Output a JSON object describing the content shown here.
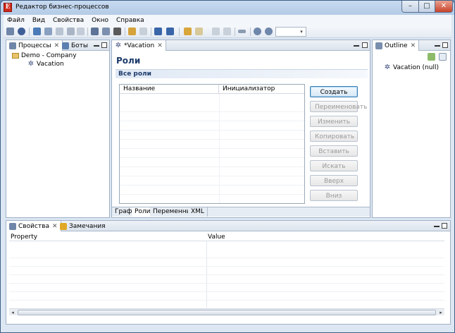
{
  "window": {
    "title": "Редактор бизнес-процессов",
    "min_glyph": "–",
    "max_glyph": "□",
    "close_glyph": "✕"
  },
  "menu": {
    "items": [
      "Файл",
      "Вид",
      "Свойства",
      "Окно",
      "Справка"
    ]
  },
  "toolbar": {
    "zoom_value": "",
    "combo_arrow": "▾"
  },
  "processes_panel": {
    "tabs": [
      {
        "label": "Процессы",
        "close": "✕"
      },
      {
        "label": "Боты"
      }
    ],
    "tree": {
      "root": "Demo - Company",
      "child": "Vacation"
    }
  },
  "editor": {
    "tab_label": "*Vacation",
    "tab_close": "✕",
    "title": "Роли",
    "section_title": "Все роли",
    "table": {
      "columns": [
        "Название",
        "Инициализатор"
      ],
      "rows": []
    },
    "buttons": [
      "Создать",
      "Переименовать",
      "Изменить",
      "Копировать",
      "Вставить",
      "Искать",
      "Вверх",
      "Вниз"
    ],
    "bottom_tabs": [
      "Граф",
      "Роли",
      "Переменные",
      "XML"
    ],
    "active_bottom_tab": "Роли"
  },
  "outline_panel": {
    "tab_label": "Outline",
    "tab_close": "✕",
    "item": "Vacation (null)"
  },
  "properties_panel": {
    "tabs": [
      {
        "label": "Свойства",
        "close": "✕"
      },
      {
        "label": "Замечания"
      }
    ],
    "columns": [
      "Property",
      "Value"
    ],
    "scroll_left": "◂",
    "scroll_right": "▸"
  },
  "colors": {
    "accent": "#1d3b6b",
    "window_frame": "#3e5f86",
    "close_button": "#c8432b"
  }
}
